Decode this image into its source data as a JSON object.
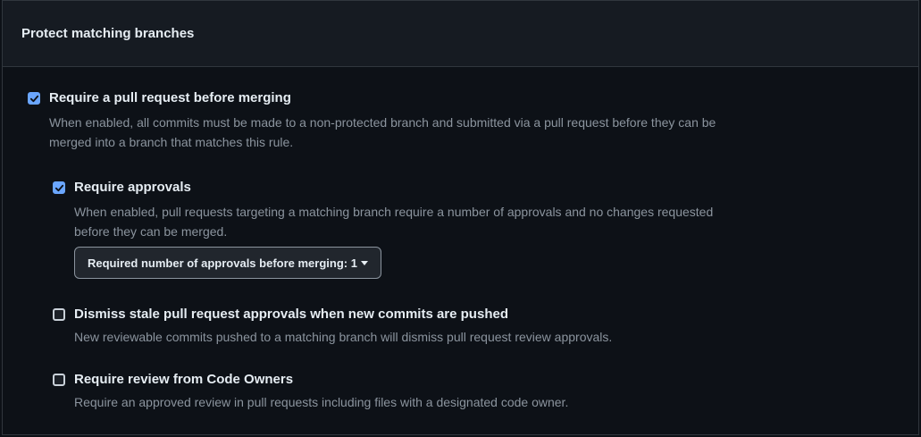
{
  "panel": {
    "title": "Protect matching branches"
  },
  "rules": {
    "pull_request": {
      "checked": true,
      "title": "Require a pull request before merging",
      "desc_line1": "When enabled, all commits must be made to a non-protected branch and submitted via a pull request before they can be",
      "desc_line2": "merged into a branch that matches this rule."
    },
    "approvals": {
      "checked": true,
      "title": "Require approvals",
      "desc_line1": "When enabled, pull requests targeting a matching branch require a number of approvals and no changes requested",
      "desc_line2": "before they can be merged.",
      "select_label": "Required number of approvals before merging: 1"
    },
    "dismiss_stale": {
      "checked": false,
      "title": "Dismiss stale pull request approvals when new commits are pushed",
      "desc": "New reviewable commits pushed to a matching branch will dismiss pull request review approvals."
    },
    "code_owners": {
      "checked": false,
      "title": "Require review from Code Owners",
      "desc": "Require an approved review in pull requests including files with a designated code owner."
    }
  },
  "colors": {
    "accent": "#6aa6ff",
    "background": "#0d1117",
    "header_background": "#161b22"
  }
}
